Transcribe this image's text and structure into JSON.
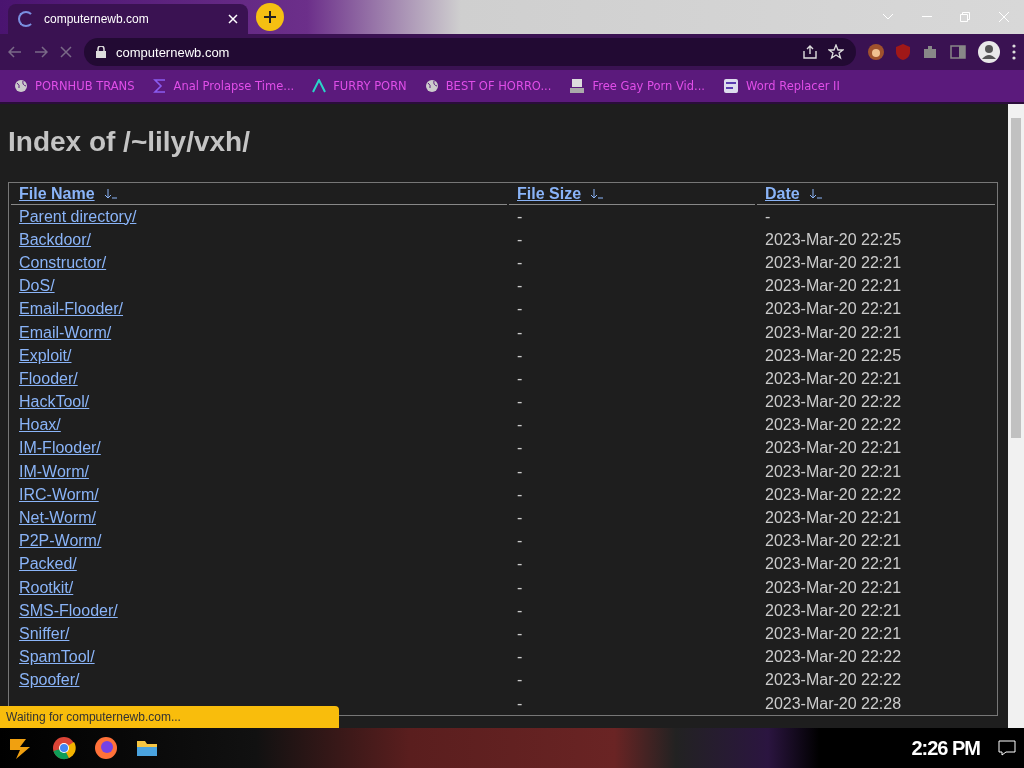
{
  "tab": {
    "title": "computernewb.com",
    "loading": true
  },
  "address": {
    "value": "computernewb.com"
  },
  "bookmarks": [
    {
      "label": "PORNHUB TRANS",
      "kind": "globe"
    },
    {
      "label": "Anal Prolapse Time...",
      "kind": "sigma"
    },
    {
      "label": "FURRY PORN",
      "kind": "lambda"
    },
    {
      "label": "BEST OF HORRO...",
      "kind": "globe"
    },
    {
      "label": "Free Gay Porn Vid...",
      "kind": "figure"
    },
    {
      "label": "Word Replacer II",
      "kind": "wr"
    }
  ],
  "page": {
    "heading": "Index of /~lily/vxh/",
    "columns": [
      "File Name",
      "File Size",
      "Date"
    ],
    "rows": [
      {
        "name": "Parent directory/",
        "size": "-",
        "date": "-"
      },
      {
        "name": "Backdoor/",
        "size": "-",
        "date": "2023-Mar-20 22:25"
      },
      {
        "name": "Constructor/",
        "size": "-",
        "date": "2023-Mar-20 22:21"
      },
      {
        "name": "DoS/",
        "size": "-",
        "date": "2023-Mar-20 22:21"
      },
      {
        "name": "Email-Flooder/",
        "size": "-",
        "date": "2023-Mar-20 22:21"
      },
      {
        "name": "Email-Worm/",
        "size": "-",
        "date": "2023-Mar-20 22:21"
      },
      {
        "name": "Exploit/",
        "size": "-",
        "date": "2023-Mar-20 22:25"
      },
      {
        "name": "Flooder/",
        "size": "-",
        "date": "2023-Mar-20 22:21"
      },
      {
        "name": "HackTool/",
        "size": "-",
        "date": "2023-Mar-20 22:22"
      },
      {
        "name": "Hoax/",
        "size": "-",
        "date": "2023-Mar-20 22:22"
      },
      {
        "name": "IM-Flooder/",
        "size": "-",
        "date": "2023-Mar-20 22:21"
      },
      {
        "name": "IM-Worm/",
        "size": "-",
        "date": "2023-Mar-20 22:21"
      },
      {
        "name": "IRC-Worm/",
        "size": "-",
        "date": "2023-Mar-20 22:22"
      },
      {
        "name": "Net-Worm/",
        "size": "-",
        "date": "2023-Mar-20 22:21"
      },
      {
        "name": "P2P-Worm/",
        "size": "-",
        "date": "2023-Mar-20 22:21"
      },
      {
        "name": "Packed/",
        "size": "-",
        "date": "2023-Mar-20 22:21"
      },
      {
        "name": "Rootkit/",
        "size": "-",
        "date": "2023-Mar-20 22:21"
      },
      {
        "name": "SMS-Flooder/",
        "size": "-",
        "date": "2023-Mar-20 22:21"
      },
      {
        "name": "Sniffer/",
        "size": "-",
        "date": "2023-Mar-20 22:21"
      },
      {
        "name": "SpamTool/",
        "size": "-",
        "date": "2023-Mar-20 22:22"
      },
      {
        "name": "Spoofer/",
        "size": "-",
        "date": "2023-Mar-20 22:22"
      },
      {
        "size": "-",
        "date": "2023-Mar-20 22:28"
      }
    ]
  },
  "status": "Waiting for computernewb.com...",
  "clock": "2:26 PM"
}
